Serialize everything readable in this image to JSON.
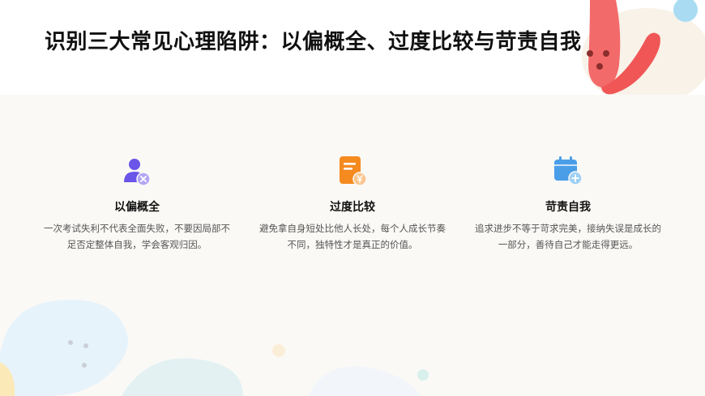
{
  "title": "识别三大常见心理陷阱：以偏概全、过度比较与苛责自我",
  "cards": [
    {
      "icon": "user-remove-icon",
      "title": "以偏概全",
      "desc": "一次考试失利不代表全面失败，不要因局部不足否定整体自我，学会客观归因。"
    },
    {
      "icon": "document-yuan-icon",
      "title": "过度比较",
      "desc": "避免拿自身短处比他人长处，每个人成长节奏不同，独特性才是真正的价值。"
    },
    {
      "icon": "calendar-add-icon",
      "title": "苛责自我",
      "desc": "追求进步不等于苛求完美，接纳失误是成长的一部分，善待自己才能走得更远。"
    }
  ],
  "colors": {
    "accent_purple": "#6a55e8",
    "accent_orange": "#f58a1f",
    "accent_blue": "#4a9ee8",
    "deco_red": "#f25c5c",
    "deco_sky": "#a9dcf3"
  }
}
